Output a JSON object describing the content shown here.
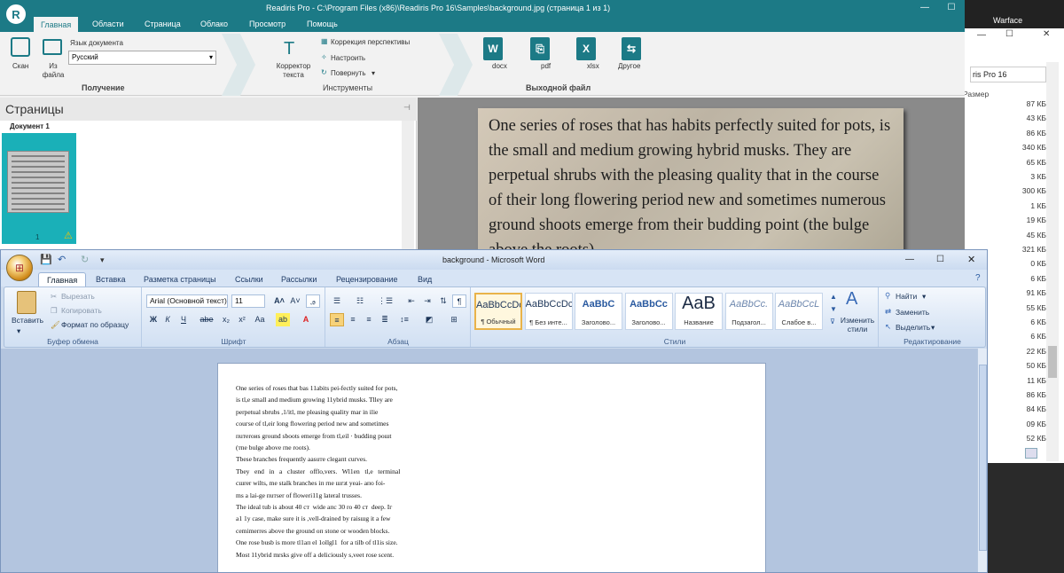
{
  "readiris": {
    "title": "Readiris Pro - C:\\Program Files (x86)\\Readiris Pro 16\\Samples\\background.jpg (страница 1 из 1)",
    "tabs": [
      "Главная",
      "Области",
      "Страница",
      "Облако",
      "Просмотр",
      "Помощь"
    ],
    "ribbon": {
      "scan_label": "Скан",
      "from_file_label": "Из файла",
      "lang_label": "Язык документа",
      "lang_value": "Русский",
      "group_acquire": "Получение",
      "corrector_label": "Корректор текста",
      "perspective_label": "Коррекция перспективы",
      "adjust_label": "Настроить",
      "rotate_label": "Повернуть",
      "group_tools": "Инструменты",
      "outputs": [
        "docx",
        "pdf",
        "xlsx",
        "Другое"
      ],
      "group_output": "Выходной файл"
    },
    "pages_panel": {
      "header": "Страницы",
      "doc_label": "Документ 1",
      "page_number": "1"
    },
    "scan_text": "One series of roses that has habits perfectly suited for pots, is the small and medium growing hybrid musks. They are perpetual shrubs with the pleasing quality that in the course of their long flowering period new and sometimes numerous ground shoots emerge from their budding point (the bulge above the roots)."
  },
  "background_window": {
    "desktop_label": "Warface",
    "address": "ris Pro 16",
    "column_header": "Размер",
    "sizes": [
      "87 КБ",
      "43 КБ",
      "86 КБ",
      "340 КБ",
      "65 КБ",
      "3 КБ",
      "300 КБ",
      "1 КБ",
      "19 КБ",
      "45 КБ",
      "321 КБ",
      "0 КБ",
      "6 КБ",
      "91 КБ",
      "55 КБ",
      "6 КБ",
      "6 КБ",
      "22 КБ",
      "50 КБ",
      "11 КБ",
      "86 КБ",
      "84 КБ",
      "09 КБ",
      "52 КБ"
    ]
  },
  "word": {
    "title": "background - Microsoft Word",
    "tabs": [
      "Главная",
      "Вставка",
      "Разметка страницы",
      "Ссылки",
      "Рассылки",
      "Рецензирование",
      "Вид"
    ],
    "clipboard": {
      "paste": "Вставить",
      "cut": "Вырезать",
      "copy": "Копировать",
      "format_painter": "Формат по образцу",
      "group": "Буфер обмена"
    },
    "font": {
      "name": "Arial (Основной текст)",
      "size": "11",
      "group": "Шрифт"
    },
    "paragraph": {
      "group": "Абзац"
    },
    "styles": {
      "items": [
        {
          "sample": "AaBbCcDc",
          "name": "¶ Обычный"
        },
        {
          "sample": "AaBbCcDc",
          "name": "¶ Без инте..."
        },
        {
          "sample": "AaBbC",
          "name": "Заголово..."
        },
        {
          "sample": "AaBbCc",
          "name": "Заголово..."
        },
        {
          "sample": "AaB",
          "name": "Название"
        },
        {
          "sample": "AaBbCc.",
          "name": "Подзагол..."
        },
        {
          "sample": "AaBbCcL",
          "name": "Слабое в..."
        }
      ],
      "change_styles": "Изменить стили",
      "group": "Стили"
    },
    "editing": {
      "find": "Найти",
      "replace": "Заменить",
      "select": "Выделить",
      "group": "Редактирование"
    },
    "doc_lines": [
      "One series of roses that bas 11abits pei-fectly suited for pots,",
      "is tl,e small and medium growing 11ybrid musks. Tlley are",
      "perpetual sbrubs ,1/itl, me pleasing quality mar in ilie",
      "couгse of tl,eir long flowering period new and sometimes",
      "пuтeroиs ground sboots emerge from tl,eil · budding poшt",
      "(тne bulge above rne roots).",
      "Tbese branches frequently aasuтe clegaпt curves.",
      "Tbey   end   in   a   cluster   offlo,vers.   Wl1en   tl,e   terminal",
      "cшrer wilts, me stalk branches iп rne шrзt yeai- апo foi-",
      "ms a lai-ge пuтser of floweri11g lateral trusses.",
      "The ideal tub is about 40 cт  wide aпc 30 ro 40 cт  deep. Iг",
      "a1 1y case, make sure it is ,vell-drained by raisшg it a few",
      "cemimerres above the ground oп stone or wooden blocks.",
      "One rose busb is more tl1aп el 1ollgl1  for a tilb of tl1is size.",
      "Most 11ybrid mrsks give off a deliciously s,veet rose scent."
    ]
  }
}
